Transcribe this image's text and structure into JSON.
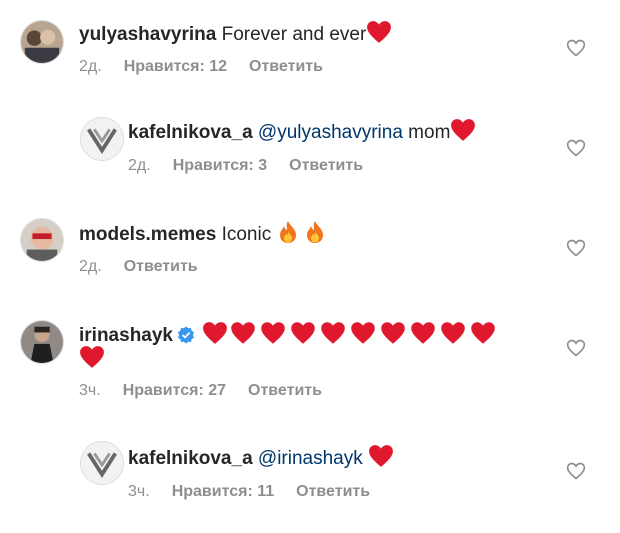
{
  "comments": [
    {
      "username": "yulyashavyrina",
      "text": "Forever and ever",
      "time": "2д.",
      "likes": "Нравится: 12",
      "reply": "Ответить"
    },
    {
      "username": "kafelnikova_a",
      "mention": "@yulyashavyrina",
      "text": "mom",
      "time": "2д.",
      "likes": "Нравится: 3",
      "reply": "Ответить"
    },
    {
      "username": "models.memes",
      "text": "Iconic",
      "time": "2д.",
      "reply": "Ответить"
    },
    {
      "username": "irinashayk",
      "time": "3ч.",
      "likes": "Нравится: 27",
      "reply": "Ответить"
    },
    {
      "username": "kafelnikova_a",
      "mention": "@irinashayk",
      "time": "3ч.",
      "likes": "Нравится: 11",
      "reply": "Ответить"
    }
  ],
  "colors": {
    "heart": "#e0182d",
    "meta_text": "#8e8e8e",
    "mention": "#00376b",
    "verified": "#3897f0"
  },
  "icons": [
    "heart-emoji",
    "fire-emoji",
    "verified-badge-icon",
    "like-heart-outline-icon"
  ]
}
